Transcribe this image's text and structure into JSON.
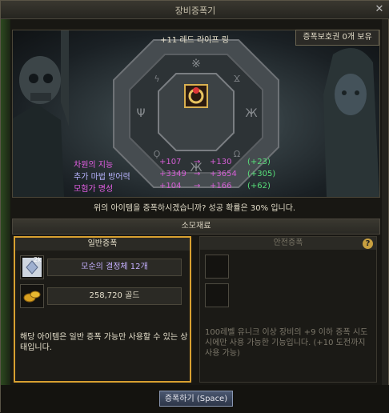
{
  "window": {
    "title": "장비증폭기",
    "close_symbol": "✕"
  },
  "item": {
    "name": "+11 레드 라이프 링",
    "protect_label": "증폭보호권 0개 보유"
  },
  "stats": [
    {
      "name": "차원의 지능",
      "from": "+107",
      "arrow": "→",
      "to": "+130",
      "diff": "(+23)",
      "color": "#e65fe6"
    },
    {
      "name": "추가 마법 방어력",
      "from": "+3349",
      "arrow": "→",
      "to": "+3654",
      "diff": "(+305)",
      "color": "#b8b4ff"
    },
    {
      "name": "모험가 명성",
      "from": "+104",
      "arrow": "→",
      "to": "+166",
      "diff": "(+62)",
      "color": "#e65fe6"
    }
  ],
  "confirm_text": "위의 아이템을 증폭하시겠습니까? 성공 확률은 30% 입니다.",
  "materials_header": "소모재료",
  "normal": {
    "title": "일반증폭",
    "materials": [
      {
        "icon": "crystal-icon",
        "count_badge": "2k",
        "label": "모순의 결정체 12개"
      },
      {
        "icon": "gold-icon",
        "label": "258,720 골드"
      }
    ],
    "description": "해당 아이템은 일반 증폭 가능만 사용할 수 있는 상태입니다."
  },
  "safe": {
    "title": "안전증폭",
    "help_symbol": "?",
    "description": "100레벨 유니크 이상 장비의 +9 이하 증폭 시도 시에만 사용 가능한 기능입니다. (+10 도전까지 사용 가능)"
  },
  "action_button": "증폭하기 (Space)",
  "colors": {
    "accent": "#d8a030",
    "stat_pink": "#e65fe6",
    "stat_green": "#58e07a",
    "stat_blue": "#b8b4ff"
  }
}
